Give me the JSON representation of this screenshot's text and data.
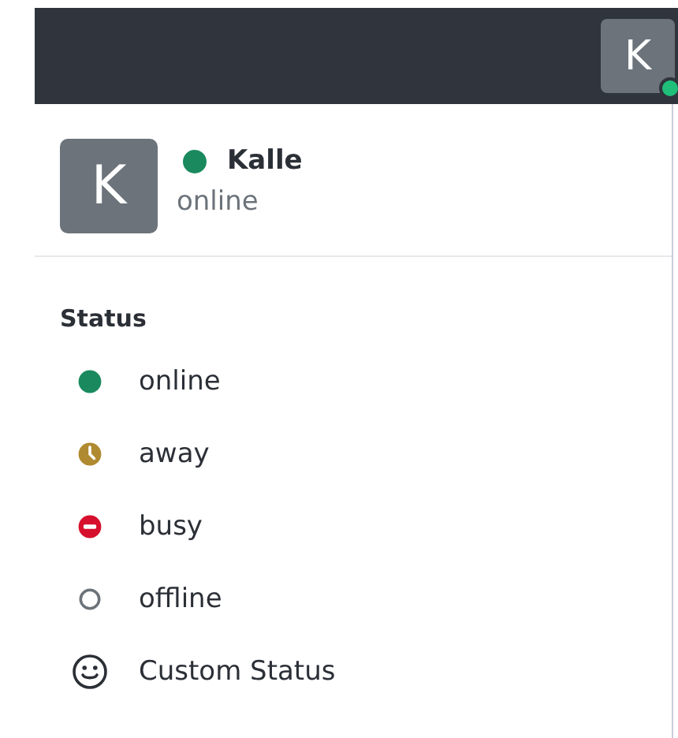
{
  "topbar": {
    "avatar": {
      "initial": "K",
      "online": true
    }
  },
  "menu": {
    "user": {
      "initial": "K",
      "online": true,
      "name": "Kalle",
      "status_text": "online"
    },
    "section_title": "Status",
    "items": [
      {
        "kind": "online",
        "label": "online"
      },
      {
        "kind": "away",
        "label": "away"
      },
      {
        "kind": "busy",
        "label": "busy"
      },
      {
        "kind": "offline",
        "label": "offline"
      },
      {
        "kind": "custom",
        "label": "Custom Status"
      }
    ]
  }
}
